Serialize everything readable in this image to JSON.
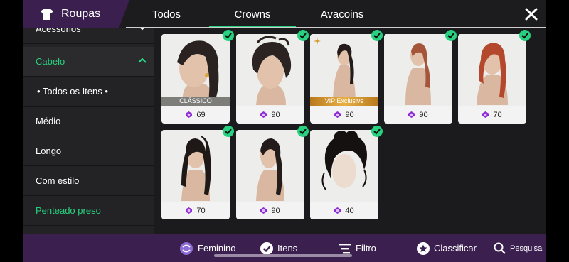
{
  "header": {
    "title": "Roupas",
    "tabs": [
      {
        "label": "Todos",
        "active": false
      },
      {
        "label": "Crowns",
        "active": true
      },
      {
        "label": "Avacoins",
        "active": false
      }
    ]
  },
  "sidebar": {
    "items": [
      {
        "label": "Acessórios",
        "state": "partial"
      },
      {
        "label": "Cabelo",
        "state": "active-expanded"
      },
      {
        "label": "• Todos os Itens •",
        "state": "sub"
      },
      {
        "label": "Médio",
        "state": "normal"
      },
      {
        "label": "Longo",
        "state": "normal"
      },
      {
        "label": "Com estilo",
        "state": "normal"
      },
      {
        "label": "Penteado preso",
        "state": "highlight"
      }
    ]
  },
  "items": [
    {
      "price": "69",
      "badge": "CLÁSSICO",
      "owned": true,
      "hair": "dark-long"
    },
    {
      "price": "90",
      "badge": "",
      "owned": true,
      "hair": "messy-updo"
    },
    {
      "price": "90",
      "badge": "VIP Exclusive",
      "owned": true,
      "hair": "dark-ponytail",
      "sparkle": true
    },
    {
      "price": "90",
      "badge": "",
      "owned": true,
      "hair": "auburn-ponytail"
    },
    {
      "price": "70",
      "badge": "",
      "owned": true,
      "hair": "red-braids"
    },
    {
      "price": "70",
      "badge": "",
      "owned": true,
      "hair": "dark-high-ponytail"
    },
    {
      "price": "90",
      "badge": "",
      "owned": true,
      "hair": "dark-sleek"
    },
    {
      "price": "40",
      "badge": "",
      "owned": true,
      "hair": "black-curly-updo"
    }
  ],
  "bottom_bar": {
    "gender": "Feminino",
    "items": "Itens",
    "filter": "Filtro",
    "sort": "Classificar",
    "search": "Pesquisa"
  },
  "colors": {
    "accent": "#27d17f",
    "brand_purple": "#3b1f4f",
    "currency": "#8d2bd6"
  }
}
